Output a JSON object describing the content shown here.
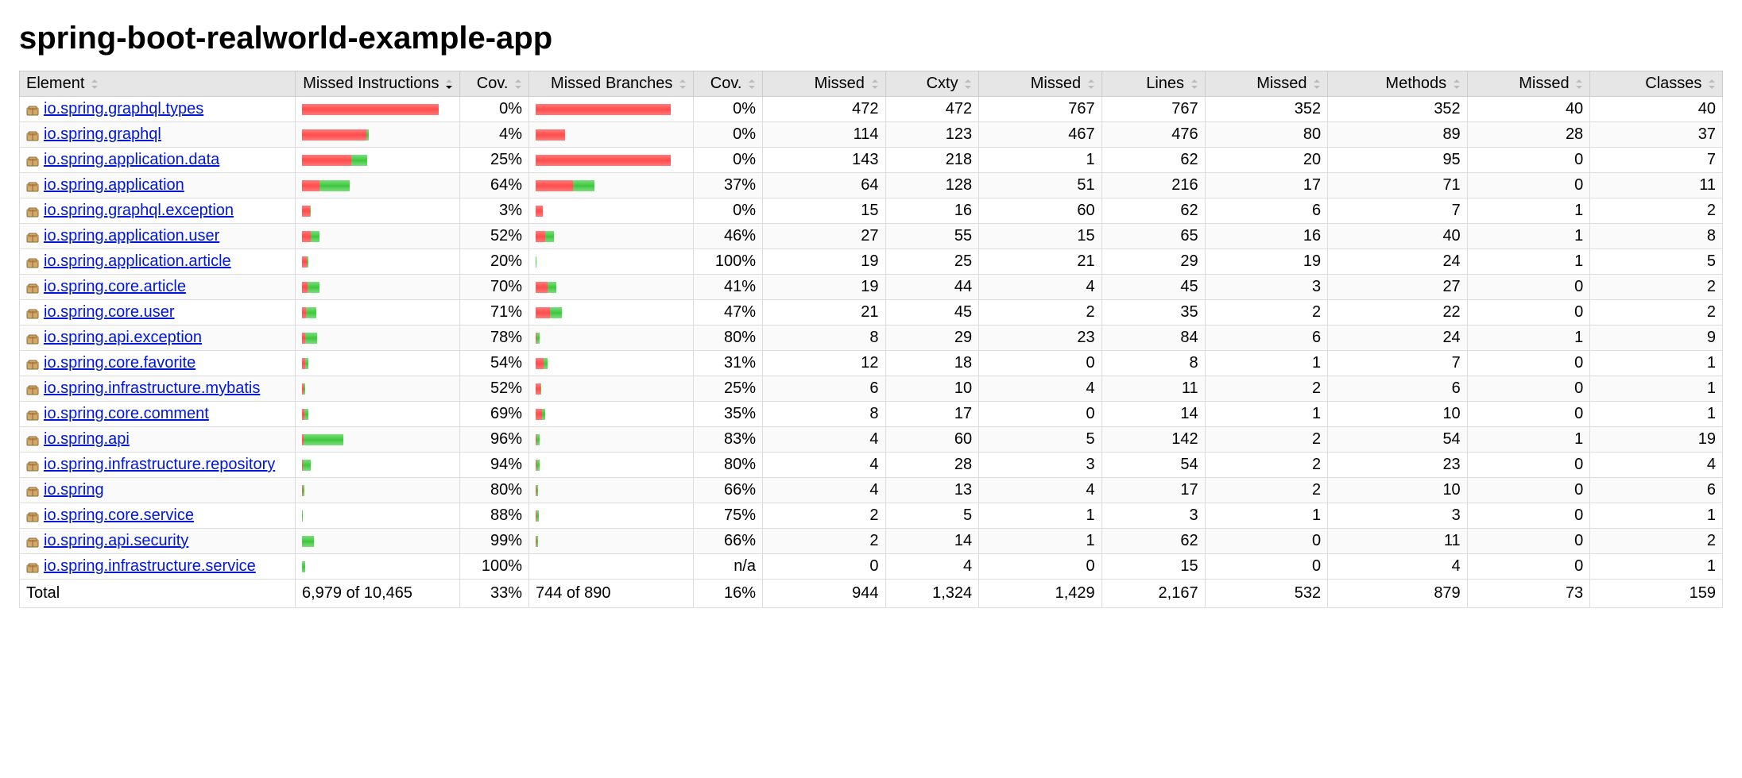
{
  "title": "spring-boot-realworld-example-app",
  "headers": {
    "element": "Element",
    "missed_instr": "Missed Instructions",
    "cov1": "Cov.",
    "missed_branches": "Missed Branches",
    "cov2": "Cov.",
    "missed": "Missed",
    "cxty": "Cxty",
    "missed_lines": "Missed",
    "lines": "Lines",
    "missed_methods": "Missed",
    "methods": "Methods",
    "missed_classes": "Missed",
    "classes": "Classes"
  },
  "instr_bar_max": 3500,
  "branch_bar_max": 380,
  "rows": [
    {
      "name": "io.spring.graphql.types",
      "instr_total": 3437,
      "instr_cov": 0,
      "cov1": "0%",
      "branch_total": 370,
      "branch_cov": 0,
      "cov2": "0%",
      "missed": 472,
      "cxty": 472,
      "mlines": 767,
      "lines": 767,
      "mmeth": 352,
      "meth": 352,
      "mclass": 40,
      "classes": 40
    },
    {
      "name": "io.spring.graphql",
      "instr_total": 1680,
      "instr_cov": 67,
      "cov1": "4%",
      "branch_total": 80,
      "branch_cov": 0,
      "cov2": "0%",
      "missed": 114,
      "cxty": 123,
      "mlines": 467,
      "lines": 476,
      "mmeth": 80,
      "meth": 89,
      "mclass": 28,
      "classes": 37
    },
    {
      "name": "io.spring.application.data",
      "instr_total": 1640,
      "instr_cov": 410,
      "cov1": "25%",
      "branch_total": 370,
      "branch_cov": 0,
      "cov2": "0%",
      "missed": 143,
      "cxty": 218,
      "mlines": 1,
      "lines": 62,
      "mmeth": 20,
      "meth": 95,
      "mclass": 0,
      "classes": 7
    },
    {
      "name": "io.spring.application",
      "instr_total": 1200,
      "instr_cov": 768,
      "cov1": "64%",
      "branch_total": 160,
      "branch_cov": 59,
      "cov2": "37%",
      "missed": 64,
      "cxty": 128,
      "mlines": 51,
      "lines": 216,
      "mmeth": 17,
      "meth": 71,
      "mclass": 0,
      "classes": 11
    },
    {
      "name": "io.spring.graphql.exception",
      "instr_total": 210,
      "instr_cov": 6,
      "cov1": "3%",
      "branch_total": 20,
      "branch_cov": 0,
      "cov2": "0%",
      "missed": 15,
      "cxty": 16,
      "mlines": 60,
      "lines": 62,
      "mmeth": 6,
      "meth": 7,
      "mclass": 1,
      "classes": 2
    },
    {
      "name": "io.spring.application.user",
      "instr_total": 440,
      "instr_cov": 229,
      "cov1": "52%",
      "branch_total": 50,
      "branch_cov": 23,
      "cov2": "46%",
      "missed": 27,
      "cxty": 55,
      "mlines": 15,
      "lines": 65,
      "mmeth": 16,
      "meth": 40,
      "mclass": 1,
      "classes": 8
    },
    {
      "name": "io.spring.application.article",
      "instr_total": 160,
      "instr_cov": 32,
      "cov1": "20%",
      "branch_total": 2,
      "branch_cov": 2,
      "cov2": "100%",
      "missed": 19,
      "cxty": 25,
      "mlines": 21,
      "lines": 29,
      "mmeth": 19,
      "meth": 24,
      "mclass": 1,
      "classes": 5
    },
    {
      "name": "io.spring.core.article",
      "instr_total": 430,
      "instr_cov": 301,
      "cov1": "70%",
      "branch_total": 56,
      "branch_cov": 23,
      "cov2": "41%",
      "missed": 19,
      "cxty": 44,
      "mlines": 4,
      "lines": 45,
      "mmeth": 3,
      "meth": 27,
      "mclass": 0,
      "classes": 2
    },
    {
      "name": "io.spring.core.user",
      "instr_total": 360,
      "instr_cov": 256,
      "cov1": "71%",
      "branch_total": 72,
      "branch_cov": 34,
      "cov2": "47%",
      "missed": 21,
      "cxty": 45,
      "mlines": 2,
      "lines": 35,
      "mmeth": 2,
      "meth": 22,
      "mclass": 0,
      "classes": 2
    },
    {
      "name": "io.spring.api.exception",
      "instr_total": 380,
      "instr_cov": 296,
      "cov1": "78%",
      "branch_total": 10,
      "branch_cov": 8,
      "cov2": "80%",
      "missed": 8,
      "cxty": 29,
      "mlines": 23,
      "lines": 84,
      "mmeth": 6,
      "meth": 24,
      "mclass": 1,
      "classes": 9
    },
    {
      "name": "io.spring.core.favorite",
      "instr_total": 160,
      "instr_cov": 86,
      "cov1": "54%",
      "branch_total": 32,
      "branch_cov": 10,
      "cov2": "31%",
      "missed": 12,
      "cxty": 18,
      "mlines": 0,
      "lines": 8,
      "mmeth": 1,
      "meth": 7,
      "mclass": 0,
      "classes": 1
    },
    {
      "name": "io.spring.infrastructure.mybatis",
      "instr_total": 84,
      "instr_cov": 44,
      "cov1": "52%",
      "branch_total": 16,
      "branch_cov": 4,
      "cov2": "25%",
      "missed": 6,
      "cxty": 10,
      "mlines": 4,
      "lines": 11,
      "mmeth": 2,
      "meth": 6,
      "mclass": 0,
      "classes": 1
    },
    {
      "name": "io.spring.core.comment",
      "instr_total": 160,
      "instr_cov": 110,
      "cov1": "69%",
      "branch_total": 26,
      "branch_cov": 9,
      "cov2": "35%",
      "missed": 8,
      "cxty": 17,
      "mlines": 0,
      "lines": 14,
      "mmeth": 1,
      "meth": 10,
      "mclass": 0,
      "classes": 1
    },
    {
      "name": "io.spring.api",
      "instr_total": 1050,
      "instr_cov": 1008,
      "cov1": "96%",
      "branch_total": 12,
      "branch_cov": 10,
      "cov2": "83%",
      "missed": 4,
      "cxty": 60,
      "mlines": 5,
      "lines": 142,
      "mmeth": 2,
      "meth": 54,
      "mclass": 1,
      "classes": 19
    },
    {
      "name": "io.spring.infrastructure.repository",
      "instr_total": 230,
      "instr_cov": 216,
      "cov1": "94%",
      "branch_total": 10,
      "branch_cov": 8,
      "cov2": "80%",
      "missed": 4,
      "cxty": 28,
      "mlines": 3,
      "lines": 54,
      "mmeth": 2,
      "meth": 23,
      "mclass": 0,
      "classes": 4
    },
    {
      "name": "io.spring",
      "instr_total": 70,
      "instr_cov": 56,
      "cov1": "80%",
      "branch_total": 6,
      "branch_cov": 4,
      "cov2": "66%",
      "missed": 4,
      "cxty": 13,
      "mlines": 4,
      "lines": 17,
      "mmeth": 2,
      "meth": 10,
      "mclass": 0,
      "classes": 6
    },
    {
      "name": "io.spring.core.service",
      "instr_total": 24,
      "instr_cov": 21,
      "cov1": "88%",
      "branch_total": 8,
      "branch_cov": 6,
      "cov2": "75%",
      "missed": 2,
      "cxty": 5,
      "mlines": 1,
      "lines": 3,
      "mmeth": 1,
      "meth": 3,
      "mclass": 0,
      "classes": 1
    },
    {
      "name": "io.spring.api.security",
      "instr_total": 300,
      "instr_cov": 297,
      "cov1": "99%",
      "branch_total": 6,
      "branch_cov": 4,
      "cov2": "66%",
      "missed": 2,
      "cxty": 14,
      "mlines": 1,
      "lines": 62,
      "mmeth": 0,
      "meth": 11,
      "mclass": 0,
      "classes": 2
    },
    {
      "name": "io.spring.infrastructure.service",
      "instr_total": 70,
      "instr_cov": 70,
      "cov1": "100%",
      "branch_total": 0,
      "branch_cov": 0,
      "cov2": "n/a",
      "missed": 0,
      "cxty": 4,
      "mlines": 0,
      "lines": 15,
      "mmeth": 0,
      "meth": 4,
      "mclass": 0,
      "classes": 1
    }
  ],
  "totals": {
    "label": "Total",
    "instr": "6,979 of 10,465",
    "cov1": "33%",
    "branches": "744 of 890",
    "cov2": "16%",
    "missed": "944",
    "cxty": "1,324",
    "mlines": "1,429",
    "lines": "2,167",
    "mmeth": "532",
    "meth": "879",
    "mclass": "73",
    "classes": "159"
  }
}
